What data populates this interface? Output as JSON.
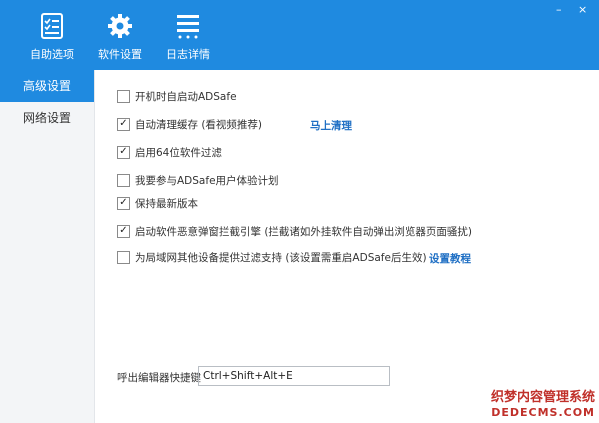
{
  "window": {
    "minimize_label": "–",
    "close_label": "×"
  },
  "nav": [
    {
      "label": "自助选项",
      "icon": "checklist-icon"
    },
    {
      "label": "软件设置",
      "icon": "gear-icon"
    },
    {
      "label": "日志详情",
      "icon": "list-icon"
    }
  ],
  "sidebar": {
    "items": [
      {
        "label": "高级设置",
        "active": true
      },
      {
        "label": "网络设置",
        "active": false
      }
    ]
  },
  "options": [
    {
      "label": "开机时自启动ADSafe",
      "checked": false
    },
    {
      "label": "自动清理缓存 (看视频推荐)",
      "checked": true,
      "link": "马上清理"
    },
    {
      "label": "启用64位软件过滤",
      "checked": true
    },
    {
      "label": "我要参与ADSafe用户体验计划",
      "checked": false
    },
    {
      "label": "保持最新版本",
      "checked": true
    },
    {
      "label": "启动软件恶意弹窗拦截引擎 (拦截诸如外挂软件自动弹出浏览器页面骚扰)",
      "checked": true
    },
    {
      "label": "为局域网其他设备提供过滤支持 (该设置需重启ADSafe后生效)",
      "checked": false,
      "link": "设置教程"
    }
  ],
  "hotkey": {
    "label": "呼出编辑器快捷键",
    "value": "Ctrl+Shift+Alt+E"
  },
  "watermark": {
    "line1": "织梦内容管理系统",
    "line2": "DEDECMS.COM"
  },
  "colors": {
    "header": "#1f8ae0",
    "link": "#1f6fc4",
    "watermark": "#c0302a"
  }
}
